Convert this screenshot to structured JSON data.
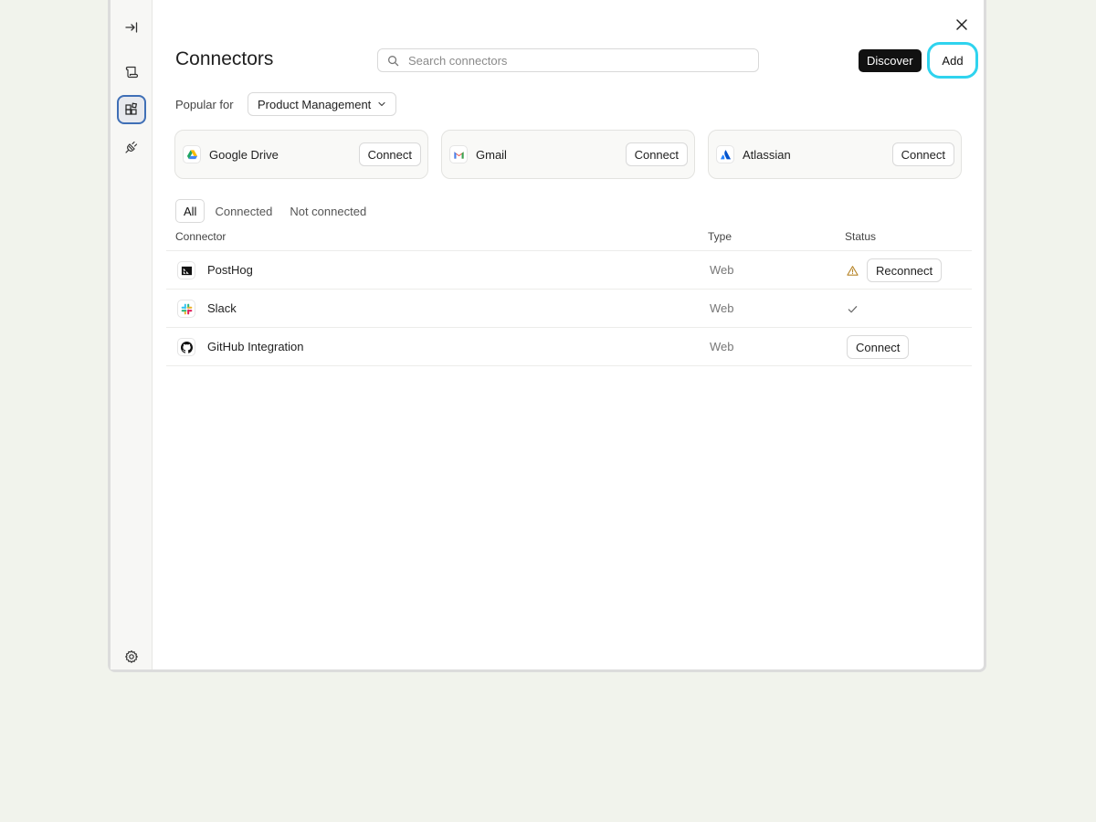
{
  "header": {
    "title": "Connectors",
    "search_placeholder": "Search connectors",
    "discover_label": "Discover",
    "add_label": "Add"
  },
  "popular": {
    "label": "Popular for",
    "selected": "Product Management",
    "cards": [
      {
        "name": "Google Drive",
        "icon": "google-drive-icon",
        "action": "Connect"
      },
      {
        "name": "Gmail",
        "icon": "gmail-icon",
        "action": "Connect"
      },
      {
        "name": "Atlassian",
        "icon": "atlassian-icon",
        "action": "Connect"
      }
    ]
  },
  "filters": {
    "all": "All",
    "connected": "Connected",
    "not_connected": "Not connected",
    "active": "All"
  },
  "table": {
    "headers": {
      "connector": "Connector",
      "type": "Type",
      "status": "Status"
    },
    "rows": [
      {
        "name": "PostHog",
        "icon": "posthog-icon",
        "type": "Web",
        "status_icon": "warning-icon",
        "status_action": "Reconnect"
      },
      {
        "name": "Slack",
        "icon": "slack-icon",
        "type": "Web",
        "status_icon": "check-icon"
      },
      {
        "name": "GitHub Integration",
        "icon": "github-icon",
        "type": "Web",
        "status_action": "Connect"
      }
    ]
  },
  "sidebar": {
    "icons": [
      "collapse-sidebar-icon",
      "scroll-icon",
      "connectors-icon",
      "plugin-icon",
      "settings-icon"
    ],
    "active": "connectors-icon"
  },
  "colors": {
    "background": "#f1f3ec",
    "accent_focus": "#2fd3ee",
    "active_outline": "#3f6fb6",
    "discover_bg": "#111111",
    "warning": "#b8862b"
  }
}
